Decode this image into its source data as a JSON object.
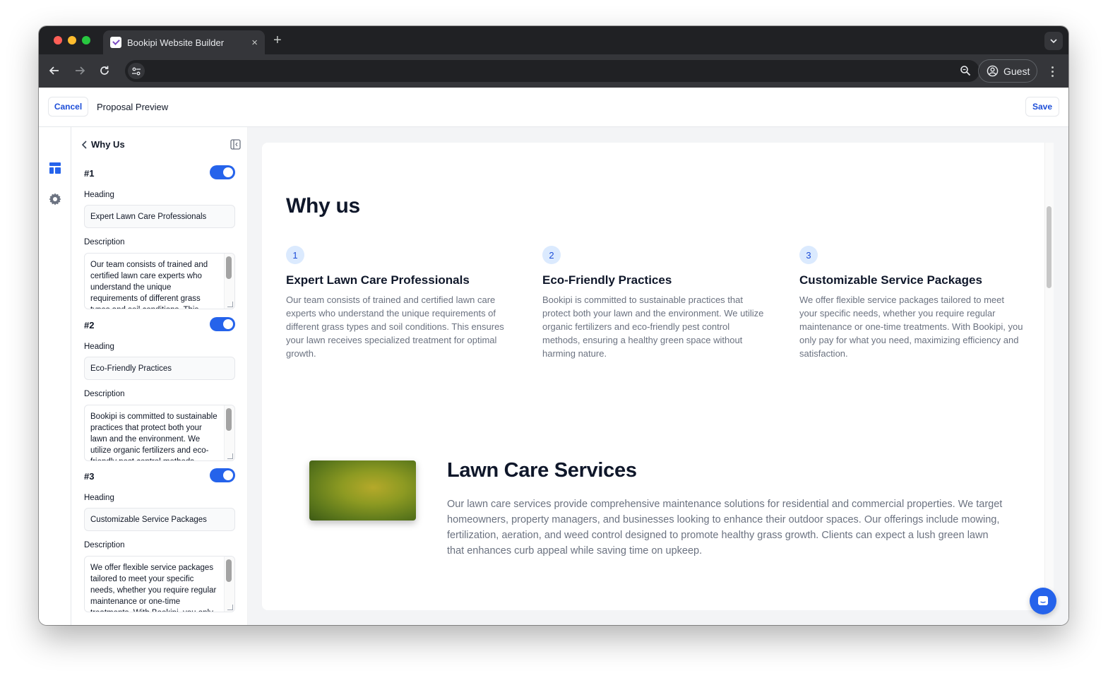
{
  "browser": {
    "tab_title": "Bookipi Website Builder",
    "tab_close": "×",
    "new_tab": "+",
    "address": "",
    "profile_label": "Guest"
  },
  "header": {
    "cancel_label": "Cancel",
    "title": "Proposal Preview",
    "save_label": "Save"
  },
  "rail": {
    "icons": [
      "layout-icon",
      "gear-icon"
    ]
  },
  "panel": {
    "title": "Why Us",
    "heading_label": "Heading",
    "description_label": "Description",
    "items": [
      {
        "number": "#1",
        "enabled": true,
        "heading": "Expert Lawn Care Professionals",
        "description": "Our team consists of trained and certified lawn care experts who understand the unique requirements of different grass types and soil conditions. This ensures your lawn receives specialized treatment for optimal growth."
      },
      {
        "number": "#2",
        "enabled": true,
        "heading": "Eco-Friendly Practices",
        "description": "Bookipi is committed to sustainable practices that protect both your lawn and the environment. We utilize organic fertilizers and eco-friendly pest control methods, ensuring a healthy green space without harming nature."
      },
      {
        "number": "#3",
        "enabled": true,
        "heading": "Customizable Service Packages",
        "description": "We offer flexible service packages tailored to meet your specific needs, whether you require regular maintenance or one-time treatments. With Bookipi, you only pay for what you need, maximizing efficiency and satisfaction."
      }
    ]
  },
  "preview": {
    "why_title": "Why us",
    "columns": [
      {
        "number": "1",
        "heading": "Expert Lawn Care Professionals",
        "text": "Our team consists of trained and certified lawn care experts who understand the unique requirements of different grass types and soil conditions. This ensures your lawn receives specialized treatment for optimal growth."
      },
      {
        "number": "2",
        "heading": "Eco-Friendly Practices",
        "text": "Bookipi is committed to sustainable practices that protect both your lawn and the environment. We utilize organic fertilizers and eco-friendly pest control methods, ensuring a healthy green space without harming nature."
      },
      {
        "number": "3",
        "heading": "Customizable Service Packages",
        "text": "We offer flexible service packages tailored to meet your specific needs, whether you require regular maintenance or one-time treatments. With Bookipi, you only pay for what you need, maximizing efficiency and satisfaction."
      }
    ],
    "services_title": "Lawn Care Services",
    "services_text": "Our lawn care services provide comprehensive maintenance solutions for residential and commercial properties. We target homeowners, property managers, and businesses looking to enhance their outdoor spaces. Our offerings include mowing, fertilization, aeration, and weed control designed to promote healthy grass growth. Clients can expect a lush green lawn that enhances curb appeal while saving time on upkeep."
  },
  "colors": {
    "accent": "#2563eb",
    "link": "#1d4ed8",
    "badge_bg": "#dbeafe",
    "browser_dark": "#202124",
    "browser_toolbar": "#35363a"
  }
}
